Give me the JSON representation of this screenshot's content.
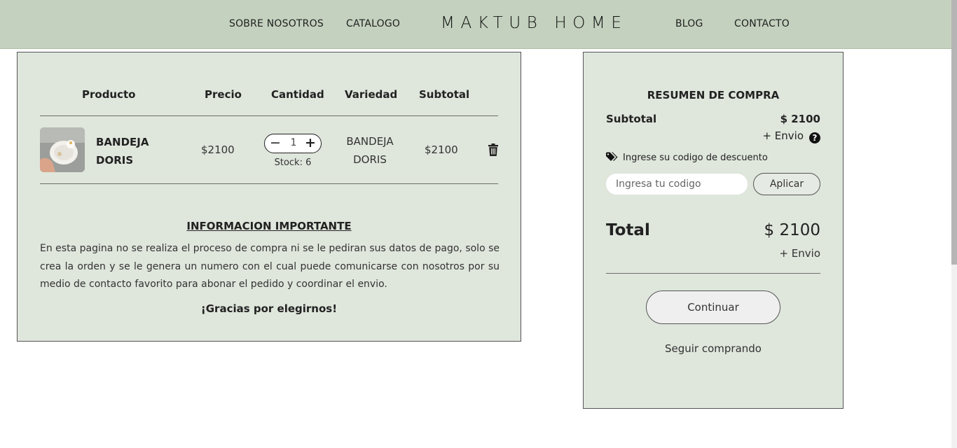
{
  "nav": {
    "about": "SOBRE NOSOTROS",
    "catalog": "CATALOGO",
    "brand": "MAKTUB HOME",
    "blog": "BLOG",
    "contact": "CONTACTO"
  },
  "cart": {
    "headers": {
      "product": "Producto",
      "price": "Precio",
      "quantity": "Cantidad",
      "variety": "Variedad",
      "subtotal": "Subtotal"
    },
    "items": [
      {
        "name": "BANDEJA DORIS",
        "price": "$2100",
        "quantity": "1",
        "stock": "Stock: 6",
        "variety": "BANDEJA DORIS",
        "subtotal": "$2100"
      }
    ],
    "minus_symbol": "−",
    "plus_symbol": "+",
    "info_title": "INFORMACION IMPORTANTE",
    "info_text": "En esta pagina no se realiza el proceso de compra ni se le pediran sus datos de pago, solo se crea la orden y se le genera un numero con el cual puede comunicarse con nosotros por su medio de contacto favorito para abonar el pedido y coordinar el envio.",
    "thanks": "¡Gracias por elegirnos!"
  },
  "summary": {
    "title": "RESUMEN DE COMPRA",
    "subtotal_label": "Subtotal",
    "subtotal_value": "$ 2100",
    "shipping_note": "+ Envio",
    "help_glyph": "?",
    "discount_label": "Ingrese su codigo de descuento",
    "discount_placeholder": "Ingresa tu codigo",
    "apply_label": "Aplicar",
    "total_label": "Total",
    "total_value": "$ 2100",
    "total_shipping_note": "+ Envio",
    "continue_label": "Continuar",
    "keep_shopping_label": "Seguir comprando"
  },
  "colors": {
    "header_bg": "#c3d1be",
    "panel_bg": "#dfe6dc"
  },
  "icons": {
    "delete": "trash-icon",
    "help": "question-circle-icon",
    "discount": "tags-icon"
  }
}
